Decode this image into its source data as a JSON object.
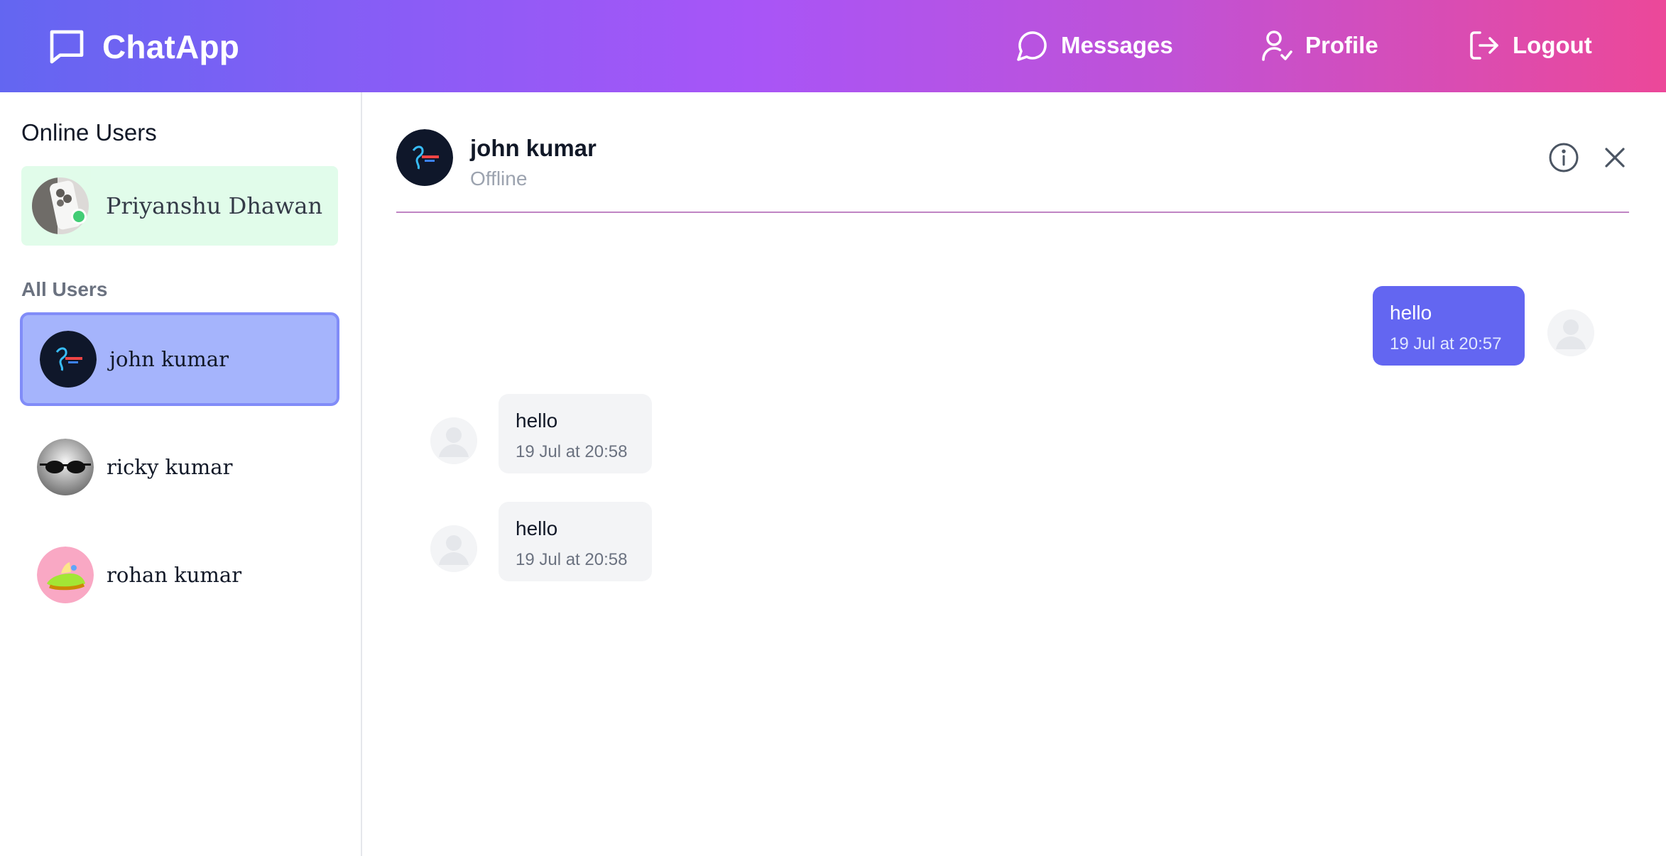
{
  "app": {
    "name": "ChatApp"
  },
  "nav": {
    "messages": "Messages",
    "profile": "Profile",
    "logout": "Logout"
  },
  "sidebar": {
    "online_title": "Online Users",
    "online_users": [
      {
        "name": "Priyanshu Dhawan",
        "status": "online"
      }
    ],
    "all_title": "All Users",
    "users": [
      {
        "name": "john kumar",
        "active": true
      },
      {
        "name": "ricky kumar",
        "active": false
      },
      {
        "name": "rohan kumar",
        "active": false
      }
    ]
  },
  "chat": {
    "contact_name": "john kumar",
    "contact_status": "Offline",
    "messages": [
      {
        "direction": "outgoing",
        "text": "hello",
        "time": "19 Jul at 20:57"
      },
      {
        "direction": "incoming",
        "text": "hello",
        "time": "19 Jul at 20:58"
      },
      {
        "direction": "incoming",
        "text": "hello",
        "time": "19 Jul at 20:58"
      }
    ]
  },
  "icons": {
    "brand": "chat-bubble-icon",
    "messages": "message-circle-icon",
    "profile": "user-check-icon",
    "logout": "logout-icon",
    "info": "info-icon",
    "close": "close-icon"
  },
  "colors": {
    "header_gradient_start": "#6366f1",
    "header_gradient_end": "#ec4899",
    "outgoing_bubble": "#6366f1",
    "incoming_bubble": "#f3f4f6",
    "active_user": "#a5b4fc",
    "online_card": "#dcfce7",
    "online_dot": "#22c55e"
  }
}
